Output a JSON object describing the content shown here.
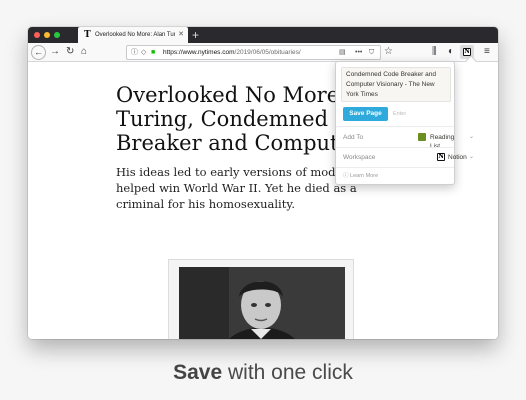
{
  "browser": {
    "tab_title": "Overlooked No More: Alan Turing",
    "tab_favicon": "T",
    "tab_close": "✕",
    "new_tab": "+",
    "url_host": "https://www.nytimes.com",
    "url_path": "/2019/06/05/obituaries/",
    "icons": [
      "back-icon",
      "forward-icon",
      "reload-icon",
      "home-icon",
      "info-icon",
      "tracking-protection-icon",
      "lock-icon",
      "reader-view-icon",
      "more-icon",
      "pocket-icon",
      "bookmark-star-icon",
      "library-icon",
      "extension-icon",
      "notion-clipper-icon",
      "menu-icon"
    ]
  },
  "article": {
    "headline": "Overlooked No More: Alan\nTuring, Condemned Code\nBreaker and Computer Vis",
    "summary": "His ideas led to early versions of modern comp helped win World War II. Yet he died as a criminal for his homosexuality."
  },
  "clipper": {
    "page_title": "Condemned Code Breaker and Computer Visionary - The New York Times",
    "save_label": "Save Page",
    "enter_hint": "Enter",
    "add_to_label": "Add To",
    "add_to_value": "Reading List",
    "workspace_label": "Workspace",
    "workspace_value": "Notion",
    "learn_more": "Learn More",
    "accent_color": "#2eaadc"
  },
  "caption": {
    "bold": "Save",
    "rest": " with one click"
  }
}
